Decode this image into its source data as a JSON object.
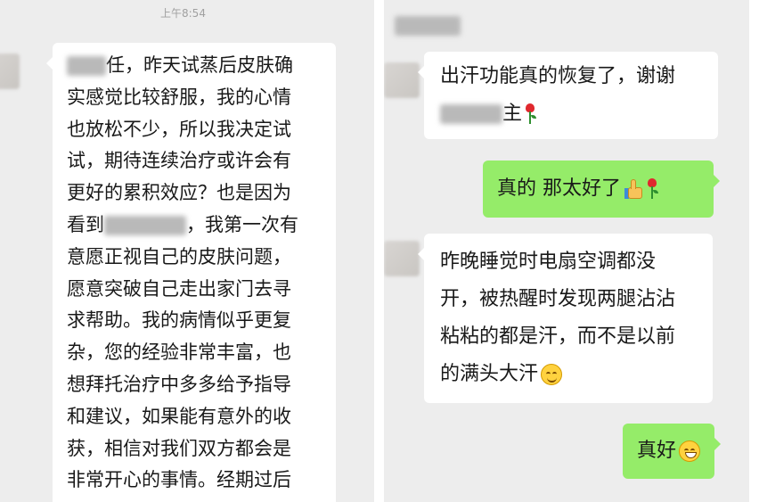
{
  "left_chat": {
    "timestamp": "上午8:54",
    "message_lines": [
      "任，昨天试蒸后皮肤确",
      "实感觉比较舒服，我的心情",
      "也放松不少，所以我决定试",
      "试，期待连续治疗或许会有",
      "更好的累积效应？也是因为",
      "看到",
      "意愿正视自己的皮肤问题，",
      "愿意突破自己走出家门去寻",
      "求帮助。我的病情似乎更复",
      "杂，您的经验非常丰富，也",
      "想拜托治疗中多多给予指导",
      "和建议，如果能有意外的收",
      "获，相信对我们双方都会是",
      "非常开心的事情。经期过后"
    ],
    "line6_tail": "，我第一次有"
  },
  "right_chat": {
    "msg1_line1": "出汗功能真的恢复了，谢谢",
    "msg1_line2_tail": "主",
    "msg2": "真的 那太好了",
    "msg3_lines": [
      "昨晚睡觉时电扇空调都没",
      "开，被热醒时发现两腿沾沾",
      "粘粘的都是汗，而不是以前",
      "的满头大汗"
    ],
    "msg4": "真好"
  },
  "icons": [
    "rose-emoji",
    "thumbs-up-emoji",
    "smile-emoji",
    "grin-emoji"
  ],
  "colors": {
    "chat_background": "#ededed",
    "incoming_bubble": "#ffffff",
    "outgoing_bubble": "#95ec69",
    "text": "#191919",
    "timestamp": "#a0a0a0"
  }
}
